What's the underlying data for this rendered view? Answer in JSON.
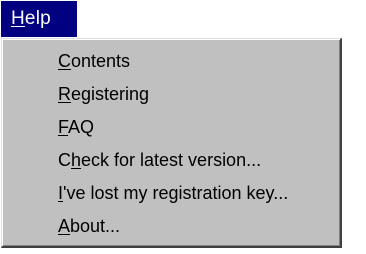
{
  "menu": {
    "title": {
      "mnemonic": "H",
      "rest": "elp"
    },
    "items": [
      {
        "mnemonic": "C",
        "rest": "ontents"
      },
      {
        "mnemonic": "R",
        "rest": "egistering"
      },
      {
        "mnemonic": "F",
        "rest": "AQ"
      },
      {
        "pre": "C",
        "mnemonic": "h",
        "rest": "eck for latest version..."
      },
      {
        "mnemonic": "I",
        "rest": "'ve lost my registration key..."
      },
      {
        "mnemonic": "A",
        "rest": "bout..."
      }
    ]
  },
  "colors": {
    "title_bg": "#000080",
    "title_text": "#ffffff",
    "menu_bg": "#c0c0c0",
    "menu_text": "#000000"
  }
}
